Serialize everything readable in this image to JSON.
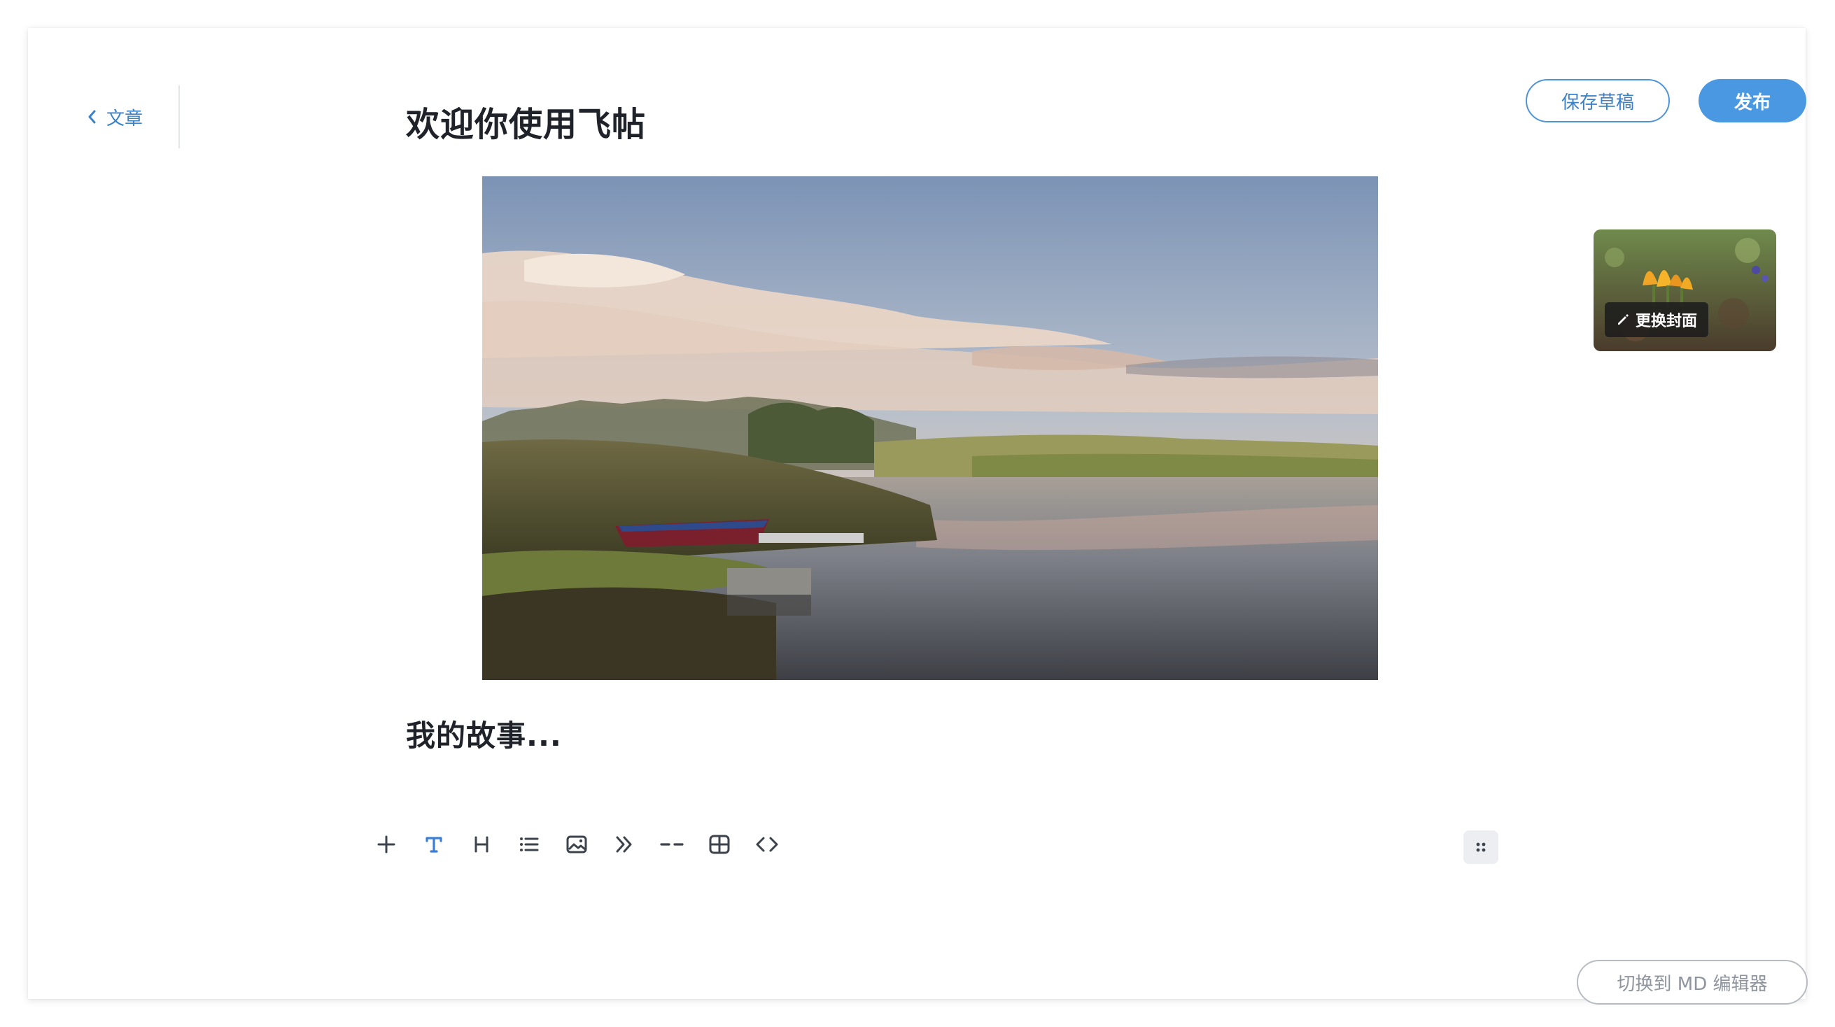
{
  "header": {
    "back_label": "文章",
    "title": "欢迎你使用飞帖",
    "save_draft_label": "保存草稿",
    "publish_label": "发布"
  },
  "cover": {
    "change_label": "更换封面"
  },
  "content": {
    "story_heading": "我的故事..."
  },
  "toolbar": {
    "items": [
      {
        "icon": "plus-icon"
      },
      {
        "icon": "text-icon",
        "active": true
      },
      {
        "icon": "heading-icon"
      },
      {
        "icon": "list-icon"
      },
      {
        "icon": "image-icon"
      },
      {
        "icon": "quote-icon"
      },
      {
        "icon": "divider-icon"
      },
      {
        "icon": "table-icon"
      },
      {
        "icon": "code-icon"
      }
    ]
  },
  "footer": {
    "switch_editor_label": "切换到 MD 编辑器"
  },
  "colors": {
    "accent": "#4a97e2",
    "link": "#3b82c9",
    "title_text": "#1f2329",
    "toolbar_icon": "#3d434c",
    "toolbar_active": "#3b7fd4",
    "muted": "#8f959e"
  }
}
